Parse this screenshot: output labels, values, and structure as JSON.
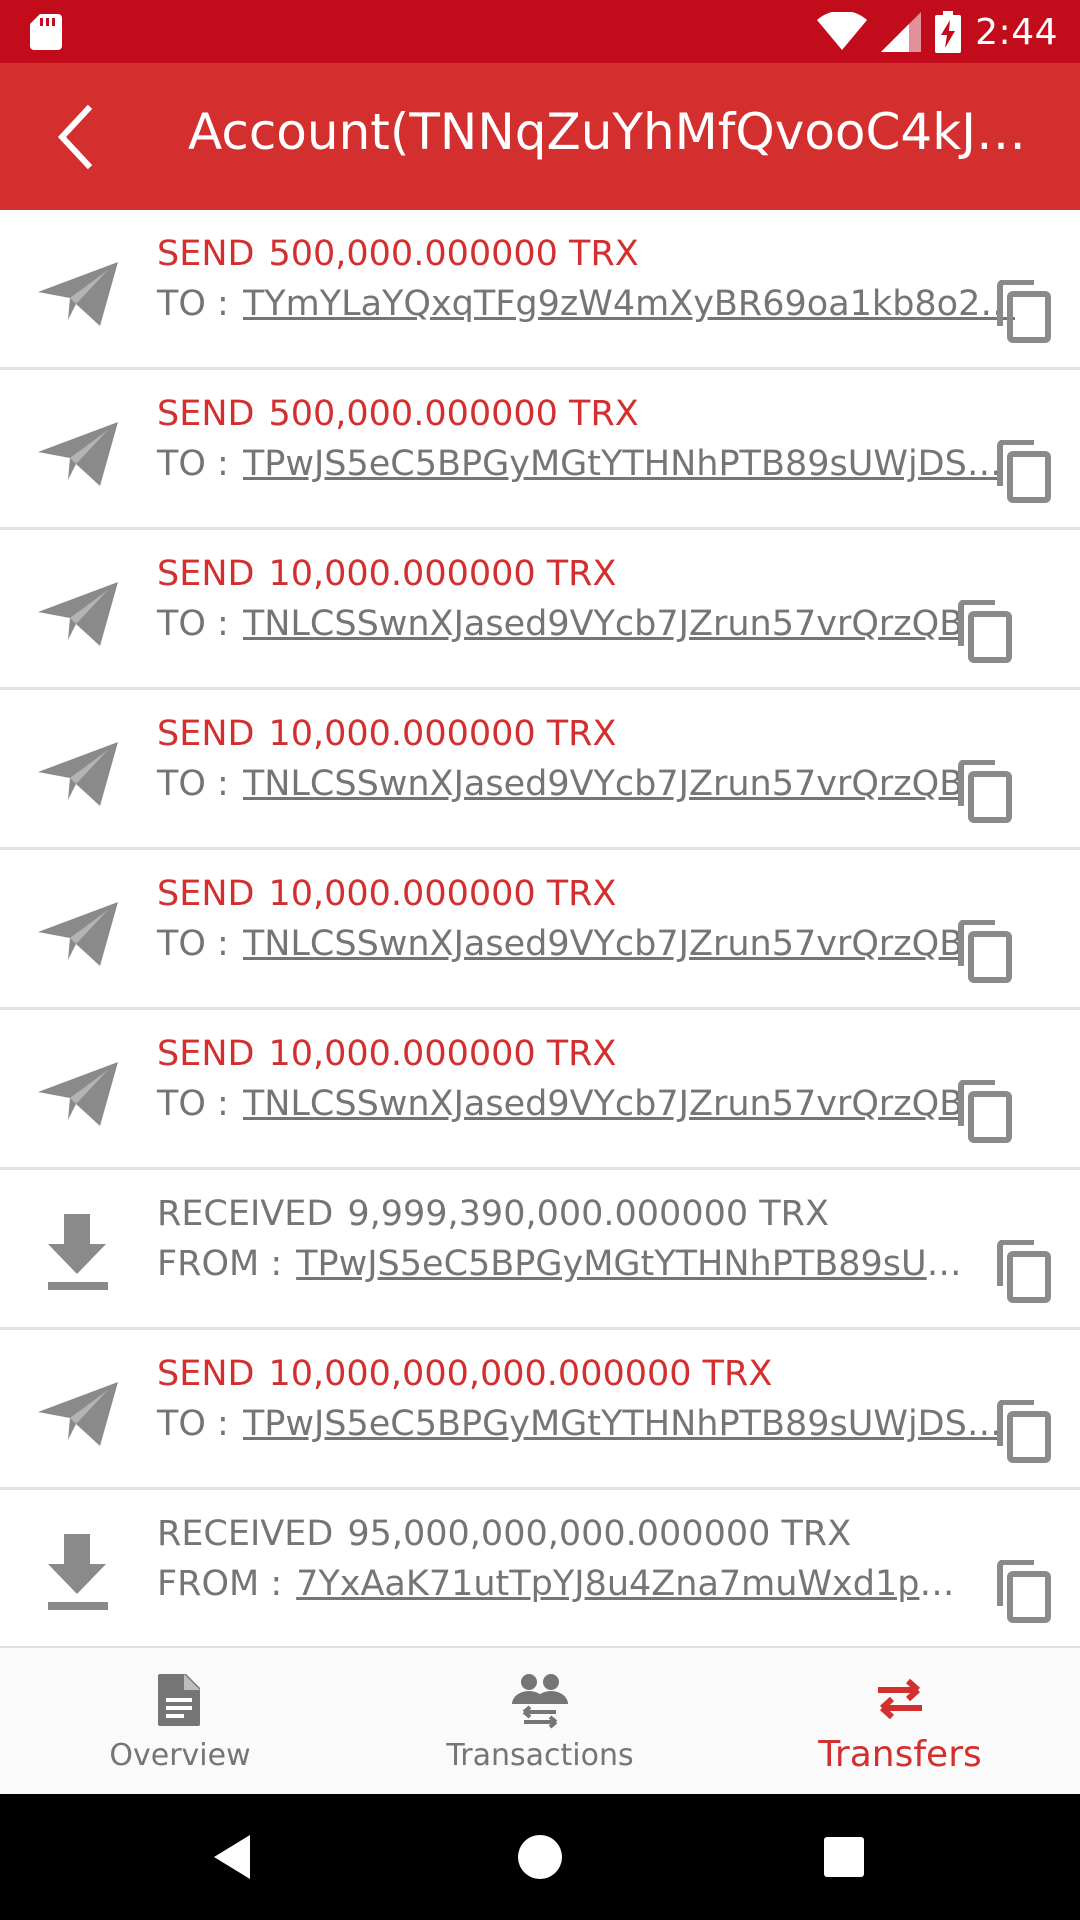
{
  "status_bar": {
    "time": "2:44",
    "icons": [
      "sd-card-icon",
      "wifi-icon",
      "signal-icon",
      "battery-charging-icon"
    ],
    "color": "#c20c1c"
  },
  "app_bar": {
    "title": "Account(TNNqZuYhMfQvooC4kJw…",
    "back_icon": "arrow-back-icon",
    "color": "#d32f2f"
  },
  "transfers": [
    {
      "type": "send",
      "kind": "SEND",
      "amount": "500,000.000000 TRX",
      "direction": "TO :",
      "address": "TYmYLaYQxqTFg9zW4mXyBR69oa1kb8o2…",
      "icon": "send-plane-icon"
    },
    {
      "type": "send",
      "kind": "SEND",
      "amount": "500,000.000000 TRX",
      "direction": "TO :",
      "address": "TPwJS5eC5BPGyMGtYTHNhPTB89sUWjDS…",
      "icon": "send-plane-icon"
    },
    {
      "type": "send",
      "kind": "SEND",
      "amount": "10,000.000000 TRX",
      "direction": "TO :",
      "address": "TNLCSSwnXJased9VYcb7JZrun57vrQrzQB",
      "icon": "send-plane-icon"
    },
    {
      "type": "send",
      "kind": "SEND",
      "amount": "10,000.000000 TRX",
      "direction": "TO :",
      "address": "TNLCSSwnXJased9VYcb7JZrun57vrQrzQB",
      "icon": "send-plane-icon"
    },
    {
      "type": "send",
      "kind": "SEND",
      "amount": "10,000.000000 TRX",
      "direction": "TO :",
      "address": "TNLCSSwnXJased9VYcb7JZrun57vrQrzQB",
      "icon": "send-plane-icon"
    },
    {
      "type": "send",
      "kind": "SEND",
      "amount": "10,000.000000 TRX",
      "direction": "TO :",
      "address": "TNLCSSwnXJased9VYcb7JZrun57vrQrzQB",
      "icon": "send-plane-icon"
    },
    {
      "type": "recv",
      "kind": "RECEIVED",
      "amount": "9,999,390,000.000000 TRX",
      "direction": "FROM :",
      "address": "TPwJS5eC5BPGyMGtYTHNhPTB89sUW…",
      "icon": "download-icon"
    },
    {
      "type": "send",
      "kind": "SEND",
      "amount": "10,000,000,000.000000 TRX",
      "direction": "TO :",
      "address": "TPwJS5eC5BPGyMGtYTHNhPTB89sUWjDS…",
      "icon": "send-plane-icon"
    },
    {
      "type": "recv",
      "kind": "RECEIVED",
      "amount": "95,000,000,000.000000 TRX",
      "direction": "FROM :",
      "address": "7YxAaK71utTpYJ8u4Zna7muWxd1pQwi…",
      "icon": "download-icon"
    }
  ],
  "colors": {
    "accent": "#d32f2f",
    "muted": "#757575",
    "icon_gray": "#8a8a8a"
  },
  "bottom_nav": {
    "items": [
      {
        "label": "Overview",
        "icon": "document-icon",
        "active": false
      },
      {
        "label": "Transactions",
        "icon": "people-swap-icon",
        "active": false
      },
      {
        "label": "Transfers",
        "icon": "swap-arrows-icon",
        "active": true
      }
    ]
  },
  "system_nav": [
    "back-triangle-icon",
    "home-circle-icon",
    "recents-square-icon"
  ]
}
